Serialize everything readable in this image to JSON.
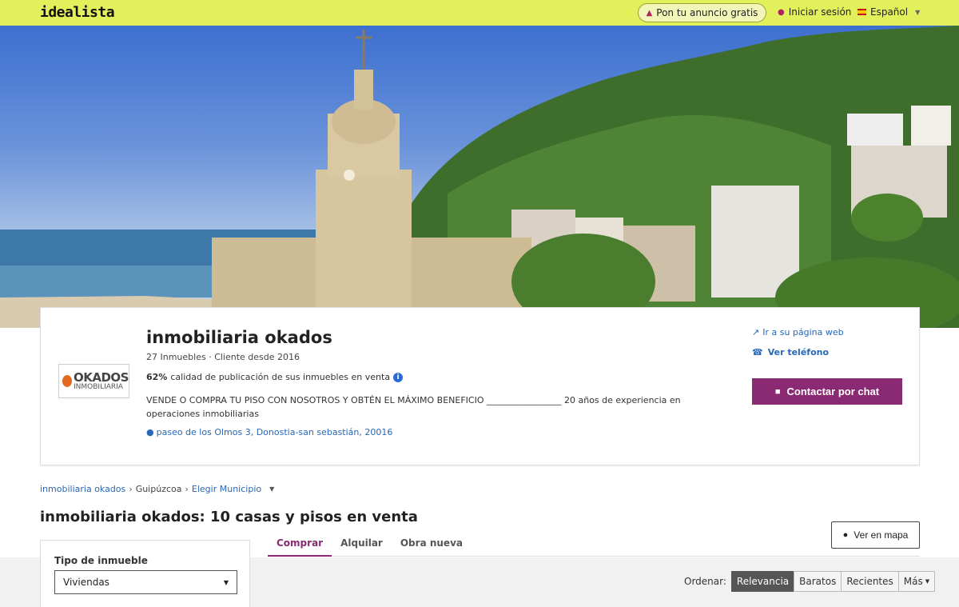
{
  "header": {
    "logo": "idealista",
    "post_ad": "Pon tu anuncio gratis",
    "login": "Iniciar sesión",
    "language": "Español"
  },
  "agency": {
    "logo_text": "OKADOS",
    "logo_subtext": "INMOBILIARIA",
    "name": "inmobiliaria okados",
    "meta": "27 Inmuebles · Cliente desde 2016",
    "quality_percent": "62%",
    "quality_text": "calidad de publicación de sus inmuebles en venta",
    "description": "VENDE O COMPRA TU PISO CON NOSOTROS Y OBTÉN EL MÁXIMO BENEFICIO _________________ 20 años de experiencia en operaciones inmobiliarias",
    "address": "paseo de los Olmos 3, Donostia-san sebastián, 20016",
    "website_link": "Ir a su página web",
    "phone_link": "Ver teléfono",
    "chat_button": "Contactar por chat"
  },
  "breadcrumb": {
    "agency": "inmobiliaria okados",
    "province": "Guipúzcoa",
    "municipality": "Elegir Municipio"
  },
  "listing": {
    "title": "inmobiliaria okados: 10 casas y pisos en venta",
    "map_button": "Ver en mapa",
    "tabs": [
      "Comprar",
      "Alquilar",
      "Obra nueva"
    ]
  },
  "filters": {
    "type_label": "Tipo de inmueble",
    "type_value": "Viviendas"
  },
  "sort": {
    "label": "Ordenar:",
    "options": [
      "Relevancia",
      "Baratos",
      "Recientes",
      "Más"
    ]
  },
  "colors": {
    "header_bg": "#e1f05b",
    "accent": "#8a2a72",
    "link": "#2767b8"
  }
}
